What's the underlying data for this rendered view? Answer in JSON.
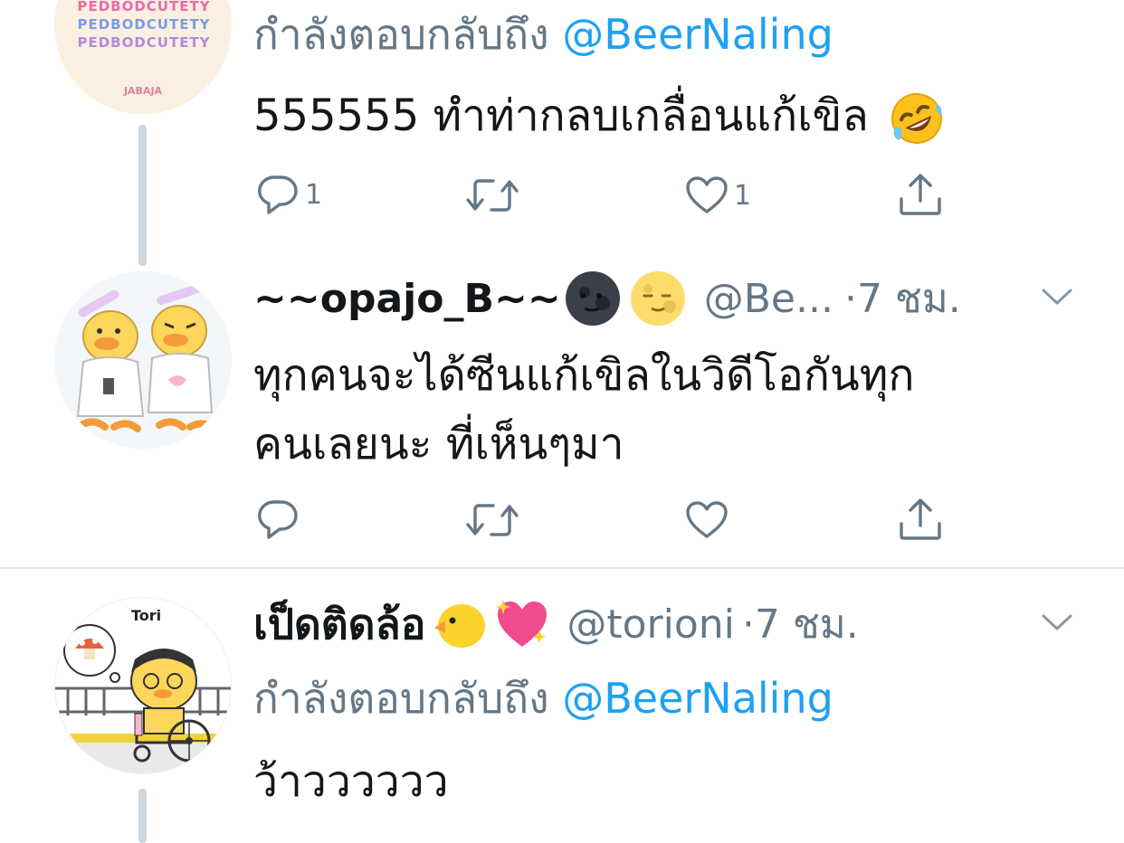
{
  "tweet1": {
    "avatar_lines": [
      "PEDBODCUTETY",
      "PEDBODCUTETY",
      "PEDBODCUTETY"
    ],
    "avatar_brand": "JABAJA",
    "replying_prefix": "กำลังตอบกลับถึง",
    "replying_handle": "@BeerNaling",
    "text": "555555 ทำท่ากลบเกลื่อนแก้เขิล",
    "reply_count": "1",
    "like_count": "1"
  },
  "tweet2": {
    "name": "~~opajo_B~~",
    "handle": "@Be...",
    "time": "·7 ชม.",
    "text_line1": "ทุกคนจะได้ซีนแก้เขิลในวิดีโอกันทุก",
    "text_line2": "คนเลยนะ ที่เห็นๆมา"
  },
  "tweet3": {
    "avatar_label": "Tori",
    "name": "เป็ดติดล้อ",
    "handle": "@torioni",
    "time": "·7 ชม.",
    "replying_prefix": "กำลังตอบกลับถึง",
    "replying_handle": "@BeerNaling",
    "text": "ว้าวววววว"
  },
  "icons": [
    "reply-icon",
    "retweet-icon",
    "like-icon",
    "share-icon",
    "chevron-down-icon",
    "rofl-emoji",
    "new-moon-face-emoji",
    "full-moon-face-emoji",
    "chick-emoji",
    "sparkling-heart-emoji"
  ],
  "colors": {
    "blue": "#1da1f2",
    "gray": "#657786",
    "line": "#ccd6dd"
  }
}
